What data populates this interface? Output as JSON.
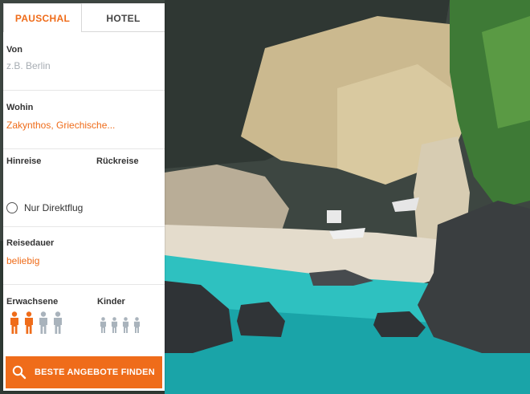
{
  "tabs": {
    "package_label": "PAUSCHAL",
    "hotel_label": "HOTEL"
  },
  "from": {
    "label": "Von",
    "placeholder": "z.B. Berlin"
  },
  "to": {
    "label": "Wohin",
    "value": "Zakynthos, Griechische..."
  },
  "dates": {
    "outbound_label": "Hinreise",
    "return_label": "Rückreise"
  },
  "direct_flight": {
    "label": "Nur Direktflug",
    "checked": false
  },
  "duration": {
    "label": "Reisedauer",
    "value": "beliebig"
  },
  "travellers": {
    "adults_label": "Erwachsene",
    "children_label": "Kinder",
    "adults_selected": 2,
    "adults_max": 4,
    "children_selected": 0,
    "children_max": 4
  },
  "cta": {
    "label": "BESTE ANGEBOTE FINDEN"
  },
  "colors": {
    "accent": "#ef6c1a",
    "inactive_person": "#a9b3bc",
    "sea": "#2ec1c0"
  }
}
